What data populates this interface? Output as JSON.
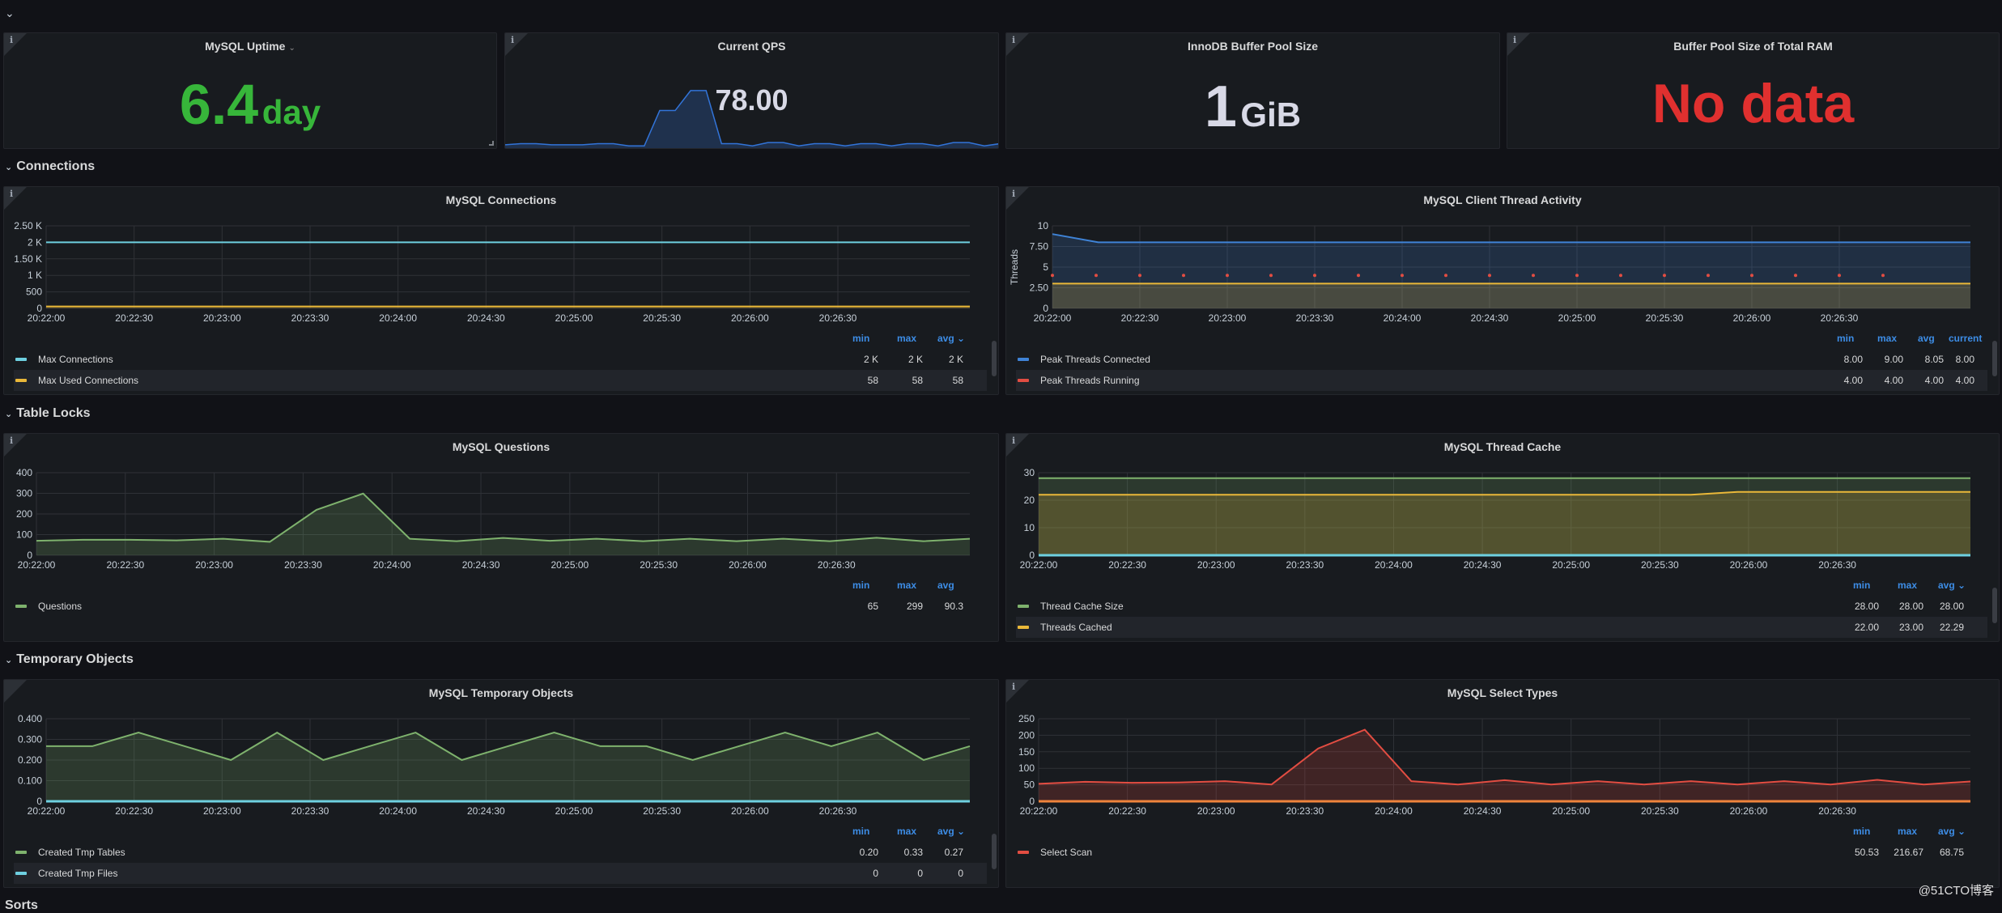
{
  "colors": {
    "green": "#37b63a",
    "red": "#e0302f",
    "white": "#d8d9e6",
    "legend_header": "#3d8de6",
    "series_cyan": "#6ed0e0",
    "series_yellow": "#eab839",
    "series_blue": "#3f83d6",
    "series_red": "#e24d42",
    "series_green": "#7eb26d",
    "series_orange": "#ef843c"
  },
  "stats": [
    {
      "title": "MySQL Uptime",
      "has_menu": true,
      "value": "6.4",
      "unit": "day",
      "color": "green"
    },
    {
      "title": "Current QPS",
      "value": "78.00",
      "unit": "",
      "color": "white"
    },
    {
      "title": "InnoDB Buffer Pool Size",
      "value": "1",
      "unit": "GiB",
      "color": "white"
    },
    {
      "title": "Buffer Pool Size of Total RAM",
      "value": "No data",
      "unit": "",
      "color": "red"
    }
  ],
  "qps_sparkline": [
    3,
    4,
    4,
    3,
    3,
    3,
    4,
    4,
    2,
    2,
    34,
    34,
    52,
    52,
    4,
    4,
    2,
    5,
    5,
    2,
    4,
    4,
    2,
    4,
    4,
    2,
    4,
    4,
    2,
    5,
    5,
    2,
    4
  ],
  "rows": [
    {
      "title": "Connections"
    },
    {
      "title": "Table Locks"
    },
    {
      "title": "Temporary Objects"
    },
    {
      "title": "Sorts"
    }
  ],
  "legend_headers": {
    "min": "min",
    "max": "max",
    "avg": "avg",
    "current": "current",
    "sort_chevron": "⌄"
  },
  "chart_data": [
    {
      "id": "connections",
      "type": "area",
      "title": "MySQL Connections",
      "ylabel": "",
      "ylim": [
        0,
        2500
      ],
      "yticks": [
        "0",
        "500",
        "1 K",
        "1.50 K",
        "2 K",
        "2.50 K"
      ],
      "ytick_values": [
        0,
        500,
        1000,
        1500,
        2000,
        2500
      ],
      "x": [
        "20:22:00",
        "20:22:30",
        "20:23:00",
        "20:23:30",
        "20:24:00",
        "20:24:30",
        "20:25:00",
        "20:25:30",
        "20:26:00",
        "20:26:30"
      ],
      "legend_columns": [
        "min",
        "max",
        "avg"
      ],
      "sorted_column": "avg",
      "series": [
        {
          "name": "Max Connections",
          "color": "series_cyan",
          "fill": false,
          "values": [
            2000,
            2000,
            2000,
            2000,
            2000,
            2000,
            2000,
            2000,
            2000,
            2000,
            2000,
            2000,
            2000,
            2000,
            2000,
            2000,
            2000,
            2000,
            2000,
            2000,
            2000
          ],
          "stats": [
            "2 K",
            "2 K",
            "2 K"
          ]
        },
        {
          "name": "Max Used Connections",
          "color": "series_yellow",
          "fill": true,
          "values": [
            58,
            58,
            58,
            58,
            58,
            58,
            58,
            58,
            58,
            58,
            58,
            58,
            58,
            58,
            58,
            58,
            58,
            58,
            58,
            58,
            58
          ],
          "stats": [
            "58",
            "58",
            "58"
          ]
        }
      ]
    },
    {
      "id": "threads",
      "type": "area",
      "title": "MySQL Client Thread Activity",
      "ylabel": "Threads",
      "ylim": [
        0,
        10
      ],
      "yticks": [
        "0",
        "2.50",
        "5",
        "7.50",
        "10"
      ],
      "ytick_values": [
        0,
        2.5,
        5,
        7.5,
        10
      ],
      "x": [
        "20:22:00",
        "20:22:30",
        "20:23:00",
        "20:23:30",
        "20:24:00",
        "20:24:30",
        "20:25:00",
        "20:25:30",
        "20:26:00",
        "20:26:30"
      ],
      "legend_columns": [
        "min",
        "max",
        "avg",
        "current"
      ],
      "series": [
        {
          "name": "Peak Threads Connected",
          "color": "series_blue",
          "fill": true,
          "values": [
            9,
            8,
            8,
            8,
            8,
            8,
            8,
            8,
            8,
            8,
            8,
            8,
            8,
            8,
            8,
            8,
            8,
            8,
            8,
            8,
            8
          ],
          "stats": [
            "8.00",
            "9.00",
            "8.05",
            "8.00"
          ]
        },
        {
          "name": "Peak Threads Running",
          "color": "series_red",
          "points": true,
          "values": [
            4,
            4,
            4,
            4,
            4,
            4,
            4,
            4,
            4,
            4,
            4,
            4,
            4,
            4,
            4,
            4,
            4,
            4,
            4,
            4
          ],
          "stats": [
            "4.00",
            "4.00",
            "4.00",
            "4.00"
          ]
        },
        {
          "name": "",
          "color": "series_yellow",
          "fill": true,
          "hidden_legend": true,
          "values": [
            3,
            3,
            3,
            3,
            3,
            3,
            3,
            3,
            3,
            3,
            3,
            3,
            3,
            3,
            3,
            3,
            3,
            3,
            3,
            3,
            3
          ]
        }
      ]
    },
    {
      "id": "questions",
      "type": "area",
      "title": "MySQL Questions",
      "ylim": [
        0,
        400
      ],
      "yticks": [
        "0",
        "100",
        "200",
        "300",
        "400"
      ],
      "ytick_values": [
        0,
        100,
        200,
        300,
        400
      ],
      "x": [
        "20:22:00",
        "20:22:30",
        "20:23:00",
        "20:23:30",
        "20:24:00",
        "20:24:30",
        "20:25:00",
        "20:25:30",
        "20:26:00",
        "20:26:30"
      ],
      "legend_columns": [
        "min",
        "max",
        "avg"
      ],
      "series": [
        {
          "name": "Questions",
          "color": "series_green",
          "fill": true,
          "values": [
            70,
            75,
            75,
            72,
            80,
            65,
            220,
            299,
            80,
            68,
            84,
            70,
            80,
            68,
            80,
            68,
            80,
            68,
            85,
            68,
            80
          ],
          "stats": [
            "65",
            "299",
            "90.3"
          ]
        }
      ]
    },
    {
      "id": "thread_cache",
      "type": "area",
      "title": "MySQL Thread Cache",
      "ylim": [
        0,
        30
      ],
      "yticks": [
        "0",
        "10",
        "20",
        "30"
      ],
      "ytick_values": [
        0,
        10,
        20,
        30
      ],
      "x": [
        "20:22:00",
        "20:22:30",
        "20:23:00",
        "20:23:30",
        "20:24:00",
        "20:24:30",
        "20:25:00",
        "20:25:30",
        "20:26:00",
        "20:26:30"
      ],
      "legend_columns": [
        "min",
        "max",
        "avg"
      ],
      "sorted_column": "avg",
      "series": [
        {
          "name": "Thread Cache Size",
          "color": "series_green",
          "fill": true,
          "values": [
            28,
            28,
            28,
            28,
            28,
            28,
            28,
            28,
            28,
            28,
            28,
            28,
            28,
            28,
            28,
            28,
            28,
            28,
            28,
            28,
            28
          ],
          "stats": [
            "28.00",
            "28.00",
            "28.00"
          ]
        },
        {
          "name": "Threads Cached",
          "color": "series_yellow",
          "fill": true,
          "values": [
            22,
            22,
            22,
            22,
            22,
            22,
            22,
            22,
            22,
            22,
            22,
            22,
            22,
            22,
            22,
            23,
            23,
            23,
            23,
            23,
            23
          ],
          "stats": [
            "22.00",
            "23.00",
            "22.29"
          ]
        },
        {
          "name": "",
          "color": "series_cyan",
          "fill": false,
          "hidden_legend": true,
          "values": [
            0,
            0,
            0,
            0,
            0,
            0,
            0,
            0,
            0,
            0,
            0,
            0,
            0,
            0,
            0,
            0,
            0,
            0,
            0,
            0,
            0
          ]
        }
      ]
    },
    {
      "id": "temp_objects",
      "type": "area",
      "title": "MySQL Temporary Objects",
      "ylim": [
        0,
        0.4
      ],
      "yticks": [
        "0",
        "0.100",
        "0.200",
        "0.300",
        "0.400"
      ],
      "ytick_values": [
        0,
        0.1,
        0.2,
        0.3,
        0.4
      ],
      "x": [
        "20:22:00",
        "20:22:30",
        "20:23:00",
        "20:23:30",
        "20:24:00",
        "20:24:30",
        "20:25:00",
        "20:25:30",
        "20:26:00",
        "20:26:30"
      ],
      "legend_columns": [
        "min",
        "max",
        "avg"
      ],
      "sorted_column": "avg",
      "series": [
        {
          "name": "Created Tmp Tables",
          "color": "series_green",
          "fill": true,
          "values": [
            0.267,
            0.267,
            0.333,
            0.267,
            0.2,
            0.333,
            0.2,
            0.267,
            0.333,
            0.2,
            0.267,
            0.333,
            0.267,
            0.267,
            0.2,
            0.267,
            0.333,
            0.267,
            0.333,
            0.2,
            0.267
          ],
          "stats": [
            "0.20",
            "0.33",
            "0.27"
          ]
        },
        {
          "name": "Created Tmp Files",
          "color": "series_cyan",
          "fill": false,
          "values": [
            0,
            0,
            0,
            0,
            0,
            0,
            0,
            0,
            0,
            0,
            0,
            0,
            0,
            0,
            0,
            0,
            0,
            0,
            0,
            0,
            0
          ],
          "stats": [
            "0",
            "0",
            "0"
          ]
        }
      ]
    },
    {
      "id": "select_types",
      "type": "area",
      "title": "MySQL Select Types",
      "ylim": [
        0,
        250
      ],
      "yticks": [
        "0",
        "50",
        "100",
        "150",
        "200",
        "250"
      ],
      "ytick_values": [
        0,
        50,
        100,
        150,
        200,
        250
      ],
      "x": [
        "20:22:00",
        "20:22:30",
        "20:23:00",
        "20:23:30",
        "20:24:00",
        "20:24:30",
        "20:25:00",
        "20:25:30",
        "20:26:00",
        "20:26:30"
      ],
      "legend_columns": [
        "min",
        "max",
        "avg"
      ],
      "sorted_column": "avg",
      "series": [
        {
          "name": "Select Scan",
          "color": "series_red",
          "fill": true,
          "values": [
            53,
            59,
            56,
            57,
            61,
            51,
            160,
            216.67,
            61,
            51,
            64,
            51,
            61,
            51,
            61,
            51,
            61,
            51,
            65,
            51,
            60
          ],
          "stats": [
            "50.53",
            "216.67",
            "68.75"
          ]
        },
        {
          "name": "",
          "color": "series_orange",
          "fill": false,
          "hidden_legend": true,
          "values": [
            0,
            0,
            0,
            0,
            0,
            0,
            0,
            0,
            0,
            0,
            0,
            0,
            0,
            0,
            0,
            0,
            0,
            0,
            0,
            0,
            0
          ]
        }
      ]
    }
  ],
  "watermark": "@51CTO博客"
}
